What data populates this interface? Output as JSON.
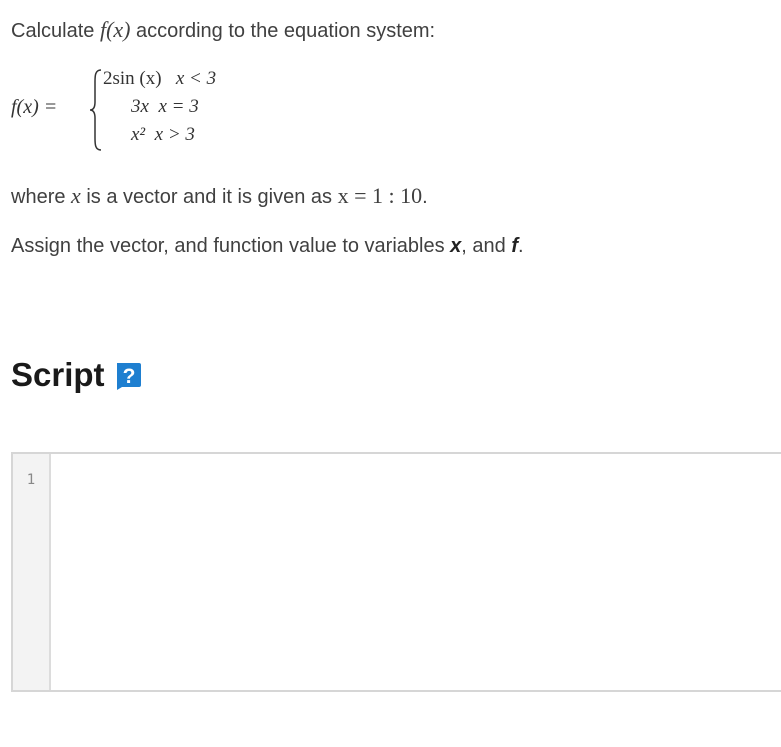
{
  "intro": {
    "before": "Calculate ",
    "func": "f",
    "arg": "(x)",
    "after": " according to the equation system:"
  },
  "equation": {
    "lhs": "f(x) =",
    "cases": [
      {
        "expr": "2sin (x)",
        "cond": "x < 3"
      },
      {
        "expr": "3x",
        "cond": "x = 3"
      },
      {
        "expr": "x²",
        "cond": "x > 3"
      }
    ]
  },
  "vector_note": {
    "before": "where ",
    "var": "x",
    "middle": " is a vector and it is given as ",
    "expr": "x = 1 : 10",
    "after": "."
  },
  "assign_note": {
    "before": "Assign the vector, and function value to variables ",
    "var_x": "x",
    "between": ", and ",
    "var_f": "f",
    "after": "."
  },
  "script_section": {
    "heading": "Script",
    "help_icon": "question-badge-icon"
  },
  "editor": {
    "line_numbers": [
      "1"
    ],
    "code": ""
  },
  "colors": {
    "help_badge": "#1e7fd0"
  }
}
